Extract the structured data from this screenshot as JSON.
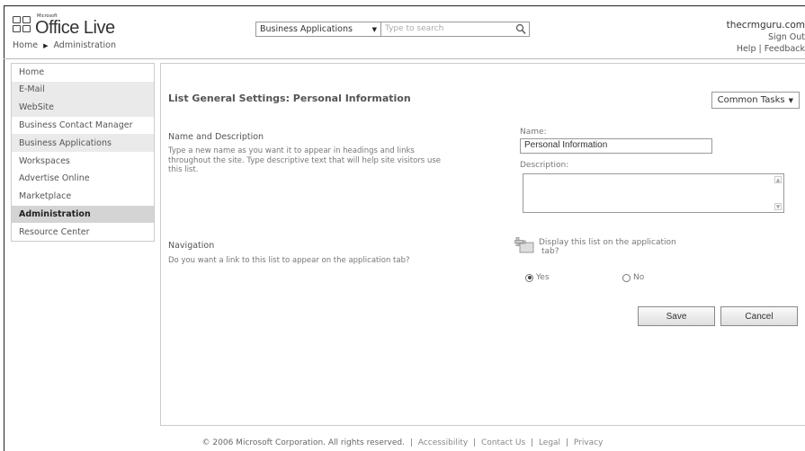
{
  "header": {
    "logo_small": "Microsoft",
    "logo_text": "Office Live",
    "breadcrumb": [
      "Home",
      "Administration"
    ],
    "search": {
      "scope": "Business Applications",
      "placeholder": "Type to search"
    },
    "user": "thecrmguru.com",
    "sign_out": "Sign Out",
    "help": "Help",
    "separator": "|",
    "feedback": "Feedback"
  },
  "sidebar": {
    "items": [
      {
        "label": "Home"
      },
      {
        "label": "E-Mail"
      },
      {
        "label": "WebSite"
      },
      {
        "label": "Business Contact Manager"
      },
      {
        "label": "Business Applications"
      },
      {
        "label": "Workspaces"
      },
      {
        "label": "Advertise Online"
      },
      {
        "label": "Marketplace"
      },
      {
        "label": "Administration"
      },
      {
        "label": "Resource Center"
      }
    ]
  },
  "main": {
    "title": "List General Settings: Personal Information",
    "common_tasks": "Common Tasks",
    "name_section": {
      "title": "Name and Description",
      "desc_line1": "Type a new name as you want it to appear in headings and links",
      "desc_line2": "throughout the site. Type descriptive text that will help site visitors use",
      "desc_line3": "this list.",
      "name_label": "Name:",
      "name_value": "Personal Information",
      "description_label": "Description:"
    },
    "nav_section": {
      "title": "Navigation",
      "desc": "Do you want a link to this list to appear on the application tab?",
      "display_text_line1": "Display this list on the application",
      "display_text_line2": "tab?",
      "yes": "Yes",
      "no": "No",
      "selected": "Yes"
    },
    "save": "Save",
    "cancel": "Cancel"
  },
  "footer": {
    "copyright": "© 2006 Microsoft Corporation. All rights reserved.",
    "links": [
      "Accessibility",
      "Contact Us",
      "Legal",
      "Privacy"
    ]
  }
}
